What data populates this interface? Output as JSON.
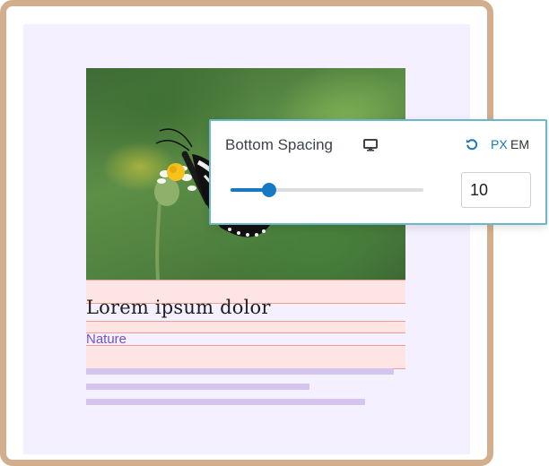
{
  "post": {
    "image_alt": "Butterfly on a daisy",
    "title": "Lorem ipsum dolor",
    "category": "Nature"
  },
  "panel": {
    "label": "Bottom Spacing",
    "device_icon": "desktop-icon",
    "reset_icon": "reset-icon",
    "units": [
      "PX",
      "EM"
    ],
    "active_unit": "PX",
    "value": "10",
    "slider_fraction": 0.2,
    "accent_color": "#1579c4"
  },
  "colors": {
    "frame": "#d3ae8d",
    "canvas": "#f4f0ff",
    "spacing_highlight": "#ffe4e4",
    "category": "#7a4fc4",
    "placeholder_lines": "#d5c4ee",
    "panel_border": "#6ab7c7"
  }
}
